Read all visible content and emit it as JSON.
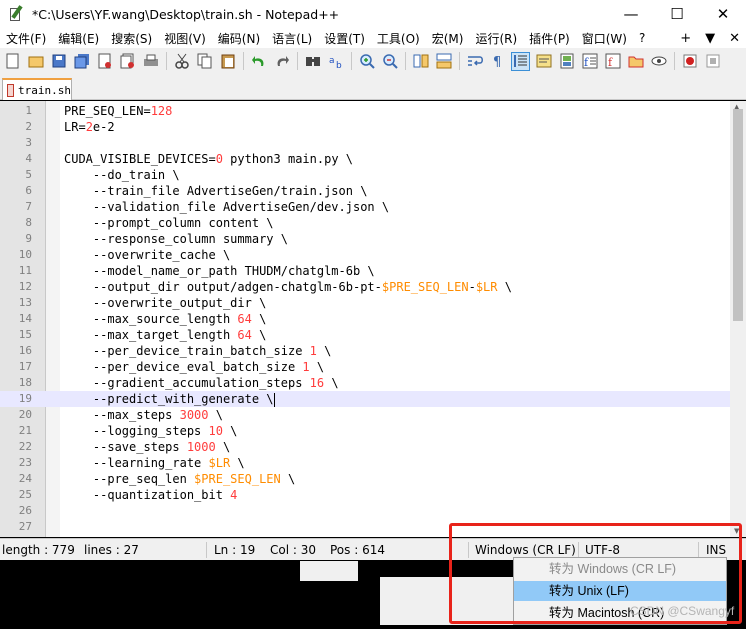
{
  "window": {
    "title": "*C:\\Users\\YF.wang\\Desktop\\train.sh - Notepad++",
    "minimize": "—",
    "maximize": "☐",
    "close": "✕"
  },
  "menu": {
    "items": [
      "文件(F)",
      "编辑(E)",
      "搜索(S)",
      "视图(V)",
      "编码(N)",
      "语言(L)",
      "设置(T)",
      "工具(O)",
      "宏(M)",
      "运行(R)",
      "插件(P)",
      "窗口(W)",
      "?"
    ],
    "right": [
      "+",
      "▼",
      "✕"
    ]
  },
  "tab": {
    "label": "train.sh",
    "icon": "unsaved-file-icon"
  },
  "editor": {
    "current_line": 19,
    "lines": [
      [
        [
          "PRE_SEQ_LEN=",
          ""
        ],
        [
          "128",
          "num"
        ]
      ],
      [
        [
          "LR=",
          ""
        ],
        [
          "2",
          "num"
        ],
        [
          "e-2",
          ""
        ]
      ],
      [],
      [
        [
          "CUDA_VISIBLE_DEVICES=",
          ""
        ],
        [
          "0",
          "num"
        ],
        [
          " python3 main.py \\",
          ""
        ]
      ],
      [
        [
          "    --do_train \\",
          ""
        ]
      ],
      [
        [
          "    --train_file AdvertiseGen/train.json \\",
          ""
        ]
      ],
      [
        [
          "    --validation_file AdvertiseGen/dev.json \\",
          ""
        ]
      ],
      [
        [
          "    --prompt_column content \\",
          ""
        ]
      ],
      [
        [
          "    --response_column summary \\",
          ""
        ]
      ],
      [
        [
          "    --overwrite_cache \\",
          ""
        ]
      ],
      [
        [
          "    --model_name_or_path THUDM/chatglm-6b \\",
          ""
        ]
      ],
      [
        [
          "    --output_dir output/adgen-chatglm-6b-pt-",
          ""
        ],
        [
          "$PRE_SEQ_LEN",
          "var"
        ],
        [
          "-",
          ""
        ],
        [
          "$LR",
          "var"
        ],
        [
          " \\",
          ""
        ]
      ],
      [
        [
          "    --overwrite_output_dir \\",
          ""
        ]
      ],
      [
        [
          "    --max_source_length ",
          ""
        ],
        [
          "64",
          "num"
        ],
        [
          " \\",
          ""
        ]
      ],
      [
        [
          "    --max_target_length ",
          ""
        ],
        [
          "64",
          "num"
        ],
        [
          " \\",
          ""
        ]
      ],
      [
        [
          "    --per_device_train_batch_size ",
          ""
        ],
        [
          "1",
          "num"
        ],
        [
          " \\",
          ""
        ]
      ],
      [
        [
          "    --per_device_eval_batch_size ",
          ""
        ],
        [
          "1",
          "num"
        ],
        [
          " \\",
          ""
        ]
      ],
      [
        [
          "    --gradient_accumulation_steps ",
          ""
        ],
        [
          "16",
          "num"
        ],
        [
          " \\",
          ""
        ]
      ],
      [
        [
          "    --predict_with_generate \\",
          ""
        ]
      ],
      [
        [
          "    --max_steps ",
          ""
        ],
        [
          "3000",
          "num"
        ],
        [
          " \\",
          ""
        ]
      ],
      [
        [
          "    --logging_steps ",
          ""
        ],
        [
          "10",
          "num"
        ],
        [
          " \\",
          ""
        ]
      ],
      [
        [
          "    --save_steps ",
          ""
        ],
        [
          "1000",
          "num"
        ],
        [
          " \\",
          ""
        ]
      ],
      [
        [
          "    --learning_rate ",
          ""
        ],
        [
          "$LR",
          "var"
        ],
        [
          " \\",
          ""
        ]
      ],
      [
        [
          "    --pre_seq_len ",
          ""
        ],
        [
          "$PRE_SEQ_LEN",
          "var"
        ],
        [
          " \\",
          ""
        ]
      ],
      [
        [
          "    --quantization_bit ",
          ""
        ],
        [
          "4",
          "num"
        ]
      ],
      [],
      []
    ]
  },
  "status": {
    "length": "length : 779",
    "lines": "lines : 27",
    "ln": "Ln : 19",
    "col": "Col : 30",
    "pos": "Pos : 614",
    "eol": "Windows (CR LF)",
    "encoding": "UTF-8",
    "ins": "INS"
  },
  "context_menu": {
    "items": [
      {
        "label": "转为 Windows (CR LF)",
        "state": "disabled"
      },
      {
        "label": "转为 Unix (LF)",
        "state": "hover"
      },
      {
        "label": "转为 Macintosh (CR)",
        "state": "normal"
      }
    ]
  },
  "watermark": "CSDN @CSwangyf",
  "colors": {
    "number": "#ff3c3c",
    "variable": "#ff8c00",
    "current_line": "#e8e8ff",
    "menu_hover": "#91c9f7",
    "annotation_red": "#e8231a"
  },
  "toolbar": {
    "icons": [
      "new-file-icon",
      "open-file-icon",
      "save-icon",
      "save-all-icon",
      "close-icon",
      "close-all-icon",
      "print-icon",
      "cut-icon",
      "copy-icon",
      "paste-icon",
      "undo-icon",
      "redo-icon",
      "find-icon",
      "replace-icon",
      "zoom-in-icon",
      "zoom-out-icon",
      "sync-vertical-icon",
      "sync-horizontal-icon",
      "word-wrap-icon",
      "show-all-chars-icon",
      "indent-guide-icon",
      "doc-map-icon",
      "function-list-icon",
      "folder-workspace-icon",
      "monitor-icon",
      "record-macro-icon",
      "stop-macro-icon"
    ]
  }
}
